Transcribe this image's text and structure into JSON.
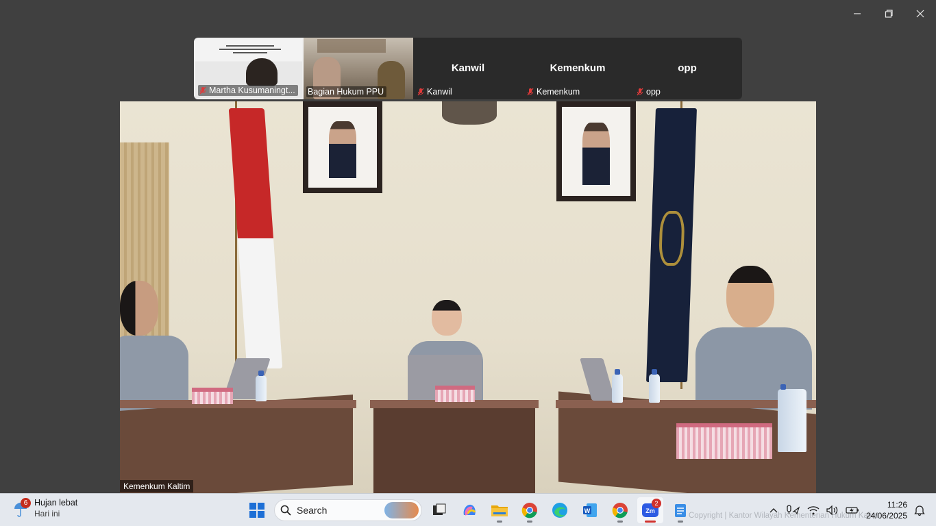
{
  "window": {
    "controls": [
      "minimize",
      "restore",
      "close"
    ]
  },
  "participants": [
    {
      "name": "Martha Kusumaningt...",
      "type": "video",
      "muted": true
    },
    {
      "name": "Bagian Hukum PPU",
      "type": "video",
      "muted": false
    },
    {
      "name": "Kanwil",
      "big_label": "Kanwil",
      "type": "avatar",
      "muted": true
    },
    {
      "name": "Kemenkum",
      "big_label": "Kemenkum",
      "type": "avatar",
      "muted": true
    },
    {
      "name": "opp",
      "big_label": "opp",
      "type": "avatar",
      "muted": true
    }
  ],
  "main_video": {
    "speaker_label": "Kemenkum Kaltim"
  },
  "taskbar": {
    "weather": {
      "badge": "6",
      "condition": "Hujan lebat",
      "day": "Hari ini"
    },
    "search_label": "Search",
    "apps": [
      {
        "name": "start",
        "icon": "windows-logo-icon"
      },
      {
        "name": "task-view",
        "icon": "task-view-icon"
      },
      {
        "name": "copilot",
        "icon": "copilot-icon"
      },
      {
        "name": "file-explorer",
        "icon": "folder-icon"
      },
      {
        "name": "chrome-profile",
        "icon": "chrome-icon"
      },
      {
        "name": "edge",
        "icon": "edge-icon"
      },
      {
        "name": "word",
        "icon": "word-icon"
      },
      {
        "name": "chrome",
        "icon": "chrome-icon"
      },
      {
        "name": "zoom",
        "icon": "zoom-icon",
        "badge": "2",
        "active": true
      },
      {
        "name": "notepad",
        "icon": "notepad-icon"
      }
    ],
    "watermark": "Copyright | Kantor Wilayah Kementerian Hukum Kalim",
    "clock": {
      "time": "11:26",
      "date": "24/06/2025"
    }
  },
  "colors": {
    "background": "#404040",
    "strip": "#2a2a2a",
    "taskbar": "#e4e8ee",
    "mute_red": "#e03a3a",
    "badge_red": "#d0312d"
  }
}
